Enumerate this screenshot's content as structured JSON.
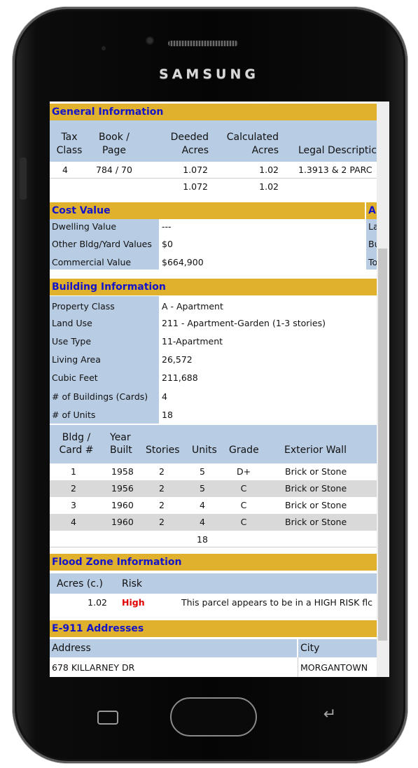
{
  "device": {
    "brand": "SAMSUNG"
  },
  "general": {
    "title": "General Information",
    "headers": {
      "tax_class": [
        "Tax",
        "Class"
      ],
      "book_page": [
        "Book /",
        "Page"
      ],
      "deeded": [
        "Deeded",
        "Acres"
      ],
      "calc": [
        "Calculated",
        "Acres"
      ],
      "legal": "Legal Descriptic"
    },
    "row": {
      "tax_class": "4",
      "book_page": "784 / 70",
      "deeded": "1.072",
      "calc": "1.02",
      "legal": "1.3913 & 2 PARC"
    },
    "totals": {
      "deeded": "1.072",
      "calc": "1.02"
    }
  },
  "cost": {
    "title": "Cost Value",
    "side_title": "A",
    "side_letters": [
      "La",
      "Bu",
      "To"
    ],
    "rows": [
      {
        "label": "Dwelling Value",
        "value": "---"
      },
      {
        "label": "Other Bldg/Yard Values",
        "value": "$0"
      },
      {
        "label": "Commercial Value",
        "value": "$664,900"
      }
    ]
  },
  "building": {
    "title": "Building Information",
    "rows": [
      {
        "label": "Property Class",
        "value": "A - Apartment"
      },
      {
        "label": "Land Use",
        "value": "211 - Apartment-Garden (1-3 stories)"
      },
      {
        "label": "Use Type",
        "value": "11-Apartment"
      },
      {
        "label": "Living Area",
        "value": "26,572"
      },
      {
        "label": "Cubic Feet",
        "value": "211,688"
      },
      {
        "label": "# of Buildings (Cards)",
        "value": "4"
      },
      {
        "label": "# of Units",
        "value": "18"
      }
    ],
    "headers": {
      "card": [
        "Bldg /",
        "Card #"
      ],
      "year": [
        "Year",
        "Built"
      ],
      "stories": "Stories",
      "units": "Units",
      "grade": "Grade",
      "wall": "Exterior Wall"
    },
    "cards": [
      {
        "card": "1",
        "year": "1958",
        "stories": "2",
        "units": "5",
        "grade": "D+",
        "wall": "Brick or Stone"
      },
      {
        "card": "2",
        "year": "1956",
        "stories": "2",
        "units": "5",
        "grade": "C",
        "wall": "Brick or Stone"
      },
      {
        "card": "3",
        "year": "1960",
        "stories": "2",
        "units": "4",
        "grade": "C",
        "wall": "Brick or Stone"
      },
      {
        "card": "4",
        "year": "1960",
        "stories": "2",
        "units": "4",
        "grade": "C",
        "wall": "Brick or Stone"
      }
    ],
    "total_units": "18"
  },
  "flood": {
    "title": "Flood Zone Information",
    "headers": {
      "acres": "Acres (c.)",
      "risk": "Risk"
    },
    "row": {
      "acres": "1.02",
      "risk": "High",
      "note": "This parcel appears to be in a HIGH RISK flc"
    }
  },
  "e911": {
    "title": "E-911 Addresses",
    "headers": {
      "address": "Address",
      "city": "City"
    },
    "row": {
      "address": "678 KILLARNEY DR",
      "city": "MORGANTOWN"
    }
  },
  "colors": {
    "section_header": "#dfb12d",
    "section_title": "#1414c8",
    "label_bg": "#b8cce4",
    "stripe": "#d9d9d9",
    "risk_high": "#e00000"
  }
}
